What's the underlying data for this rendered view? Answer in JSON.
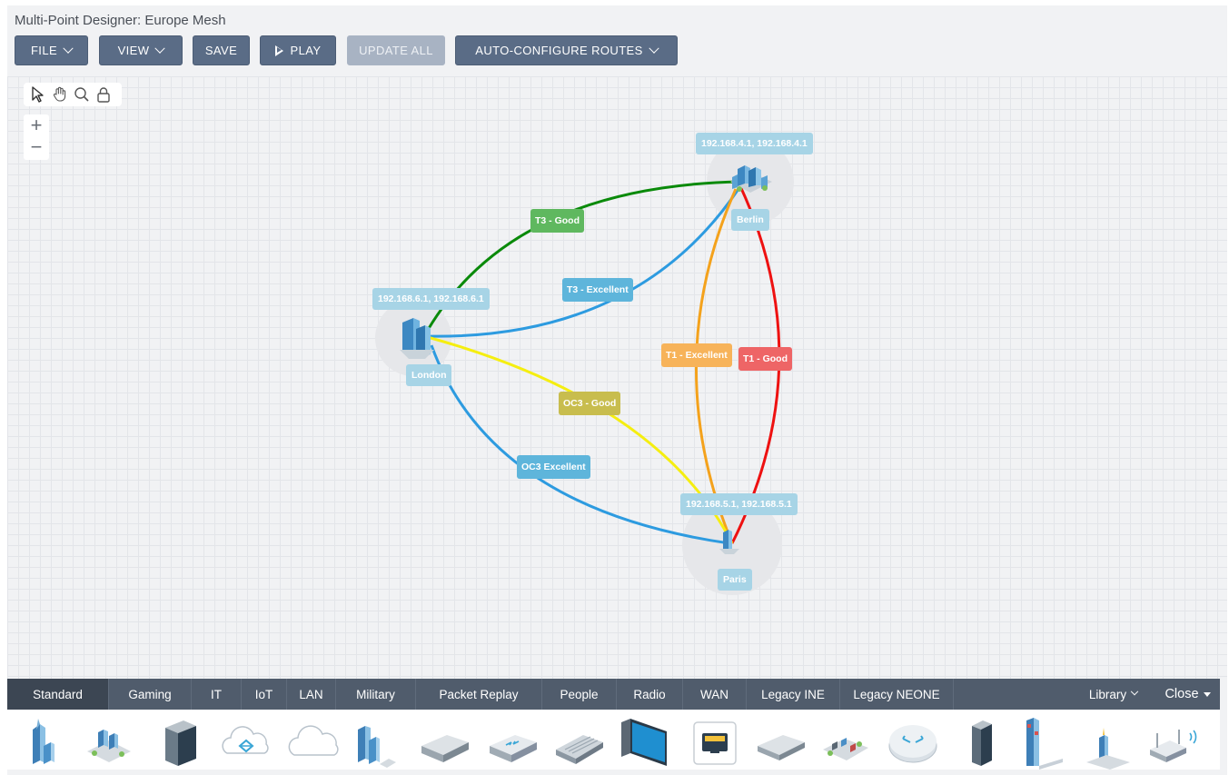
{
  "window": {
    "title": "Multi-Point Designer: Europe Mesh"
  },
  "toolbar": {
    "file": "FILE",
    "view": "VIEW",
    "save": "SAVE",
    "play": "PLAY",
    "update_all": "UPDATE ALL",
    "auto_configure": "AUTO-CONFIGURE ROUTES"
  },
  "canvas_tools": [
    "pointer-icon",
    "hand-icon",
    "zoom-search-icon",
    "lock-icon"
  ],
  "zoom": {
    "in": "+",
    "out": "−"
  },
  "nodes": {
    "london": {
      "name": "London",
      "ip": "192.168.6.1, 192.168.6.1"
    },
    "berlin": {
      "name": "Berlin",
      "ip": "192.168.4.1, 192.168.4.1"
    },
    "paris": {
      "name": "Paris",
      "ip": "192.168.5.1, 192.168.5.1"
    }
  },
  "links": [
    {
      "from": "London",
      "to": "Berlin",
      "label": "T3 - Good",
      "color": "#0a8a0a"
    },
    {
      "from": "London",
      "to": "Berlin",
      "label": "T3 - Excellent",
      "color": "#2d9be0"
    },
    {
      "from": "Berlin",
      "to": "Paris",
      "label": "T1 - Excellent",
      "color": "#f4a21c"
    },
    {
      "from": "Berlin",
      "to": "Paris",
      "label": "T1 - Good",
      "color": "#ee1111"
    },
    {
      "from": "London",
      "to": "Paris",
      "label": "OC3 - Good",
      "color": "#f5ee10"
    },
    {
      "from": "London",
      "to": "Paris",
      "label": "OC3 Excellent",
      "color": "#2d9be0"
    }
  ],
  "palette_tabs": [
    "Standard",
    "Gaming",
    "IT",
    "IoT",
    "LAN",
    "Military",
    "Packet Replay",
    "People",
    "Radio",
    "WAN",
    "Legacy INE",
    "Legacy NEONE"
  ],
  "palette_right": {
    "library": "Library",
    "close": "Close"
  },
  "palette_icons": [
    "skyscraper-icon",
    "office-campus-icon",
    "server-rack-icon",
    "network-cloud-icon",
    "plain-cloud-icon",
    "office-buildings-icon",
    "appliance-box-icon",
    "router-box-icon",
    "switch-icon",
    "desktop-monitor-icon",
    "ethernet-port-icon",
    "flat-appliance-icon",
    "data-center-icon",
    "router-disc-icon",
    "tower-server-icon",
    "skyscraper-tower-icon",
    "small-building-icon",
    "wireless-router-icon"
  ],
  "colors": {
    "toolbar_button": "#5a6c86",
    "tab_bar": "#505c6c",
    "active_tab": "#3c4653",
    "node_label": "#a7d4e6"
  }
}
